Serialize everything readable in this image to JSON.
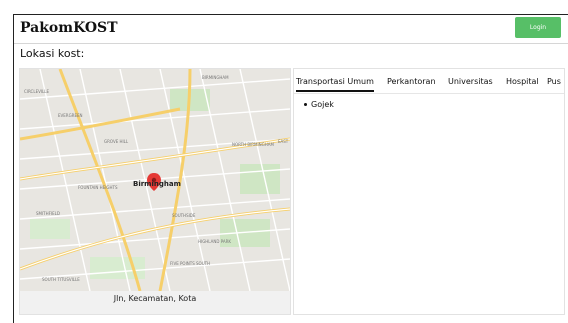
{
  "navbar": {
    "brand": "PakomKOST",
    "login_label": "Login"
  },
  "section": {
    "title": "Lokasi kost:"
  },
  "map": {
    "city_label": "Birmingham",
    "address": "Jln, Kecamatan, Kota",
    "labels": [
      "CIRCLEVILLE",
      "EVERGREEN",
      "GROVE HILL",
      "NORTH BIRMINGHAM",
      "BIRMINGHAM",
      "SMITHFIELD",
      "FOUNTAIN HEIGHTS",
      "SOUTHSIDE",
      "HIGHLAND PARK",
      "FIVE POINTS SOUTH",
      "SOUTH TITUSVILLE",
      "EAST"
    ]
  },
  "tabs": [
    {
      "label": "Transportasi Umum",
      "active": true
    },
    {
      "label": "Perkantoran",
      "active": false
    },
    {
      "label": "Universitas",
      "active": false
    },
    {
      "label": "Hospital",
      "active": false
    },
    {
      "label": "Pus",
      "active": false
    }
  ],
  "places": [
    "Gojek"
  ],
  "colors": {
    "accent": "#57bf67",
    "map_pin": "#e53935"
  }
}
